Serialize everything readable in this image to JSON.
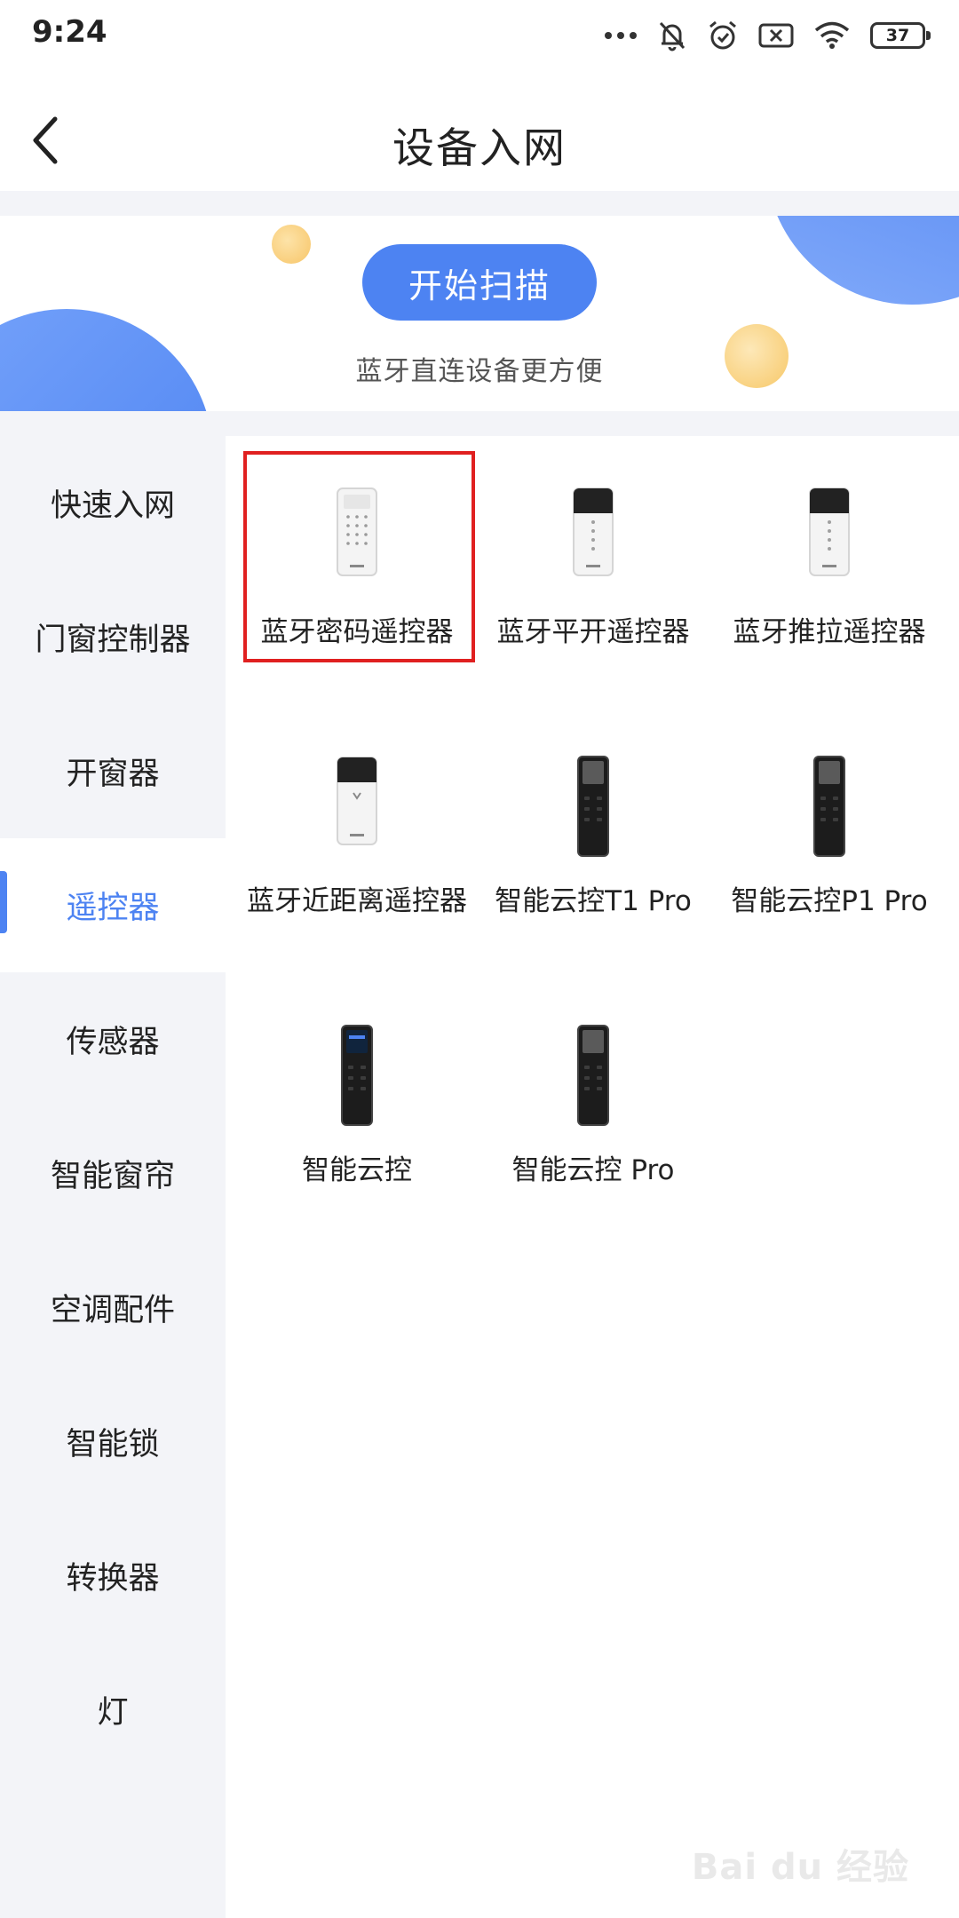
{
  "status_bar": {
    "time": "9:24",
    "battery": "37",
    "icons": [
      "more-dots-icon",
      "bell-off-icon",
      "alarm-icon",
      "sim-x-icon",
      "wifi-icon",
      "battery-icon"
    ]
  },
  "header": {
    "title": "设备入网",
    "back_icon": "chevron-left-icon"
  },
  "banner": {
    "scan_button": "开始扫描",
    "subtitle": "蓝牙直连设备更方便"
  },
  "sidebar": {
    "active_index": 3,
    "items": [
      {
        "label": "快速入网"
      },
      {
        "label": "门窗控制器"
      },
      {
        "label": "开窗器"
      },
      {
        "label": "遥控器"
      },
      {
        "label": "传感器"
      },
      {
        "label": "智能窗帘"
      },
      {
        "label": "空调配件"
      },
      {
        "label": "智能锁"
      },
      {
        "label": "转换器"
      },
      {
        "label": "灯"
      }
    ]
  },
  "devices": {
    "selected_index": 0,
    "items": [
      {
        "label": "蓝牙密码遥控器",
        "icon": "white-keypad-remote-icon"
      },
      {
        "label": "蓝牙平开遥控器",
        "icon": "white-remote-icon"
      },
      {
        "label": "蓝牙推拉遥控器",
        "icon": "white-remote-icon"
      },
      {
        "label": "蓝牙近距离遥控器",
        "icon": "white-proximity-remote-icon"
      },
      {
        "label": "智能云控T1 Pro",
        "icon": "black-remote-icon"
      },
      {
        "label": "智能云控P1 Pro",
        "icon": "black-remote-icon"
      },
      {
        "label": "智能云控",
        "icon": "black-screen-remote-icon"
      },
      {
        "label": "智能云控 Pro",
        "icon": "black-remote-icon"
      }
    ]
  },
  "watermark": "Bai du 经验",
  "colors": {
    "accent": "#4d83f2",
    "selection": "#e02020",
    "sidebar_bg": "#f3f4f8"
  }
}
